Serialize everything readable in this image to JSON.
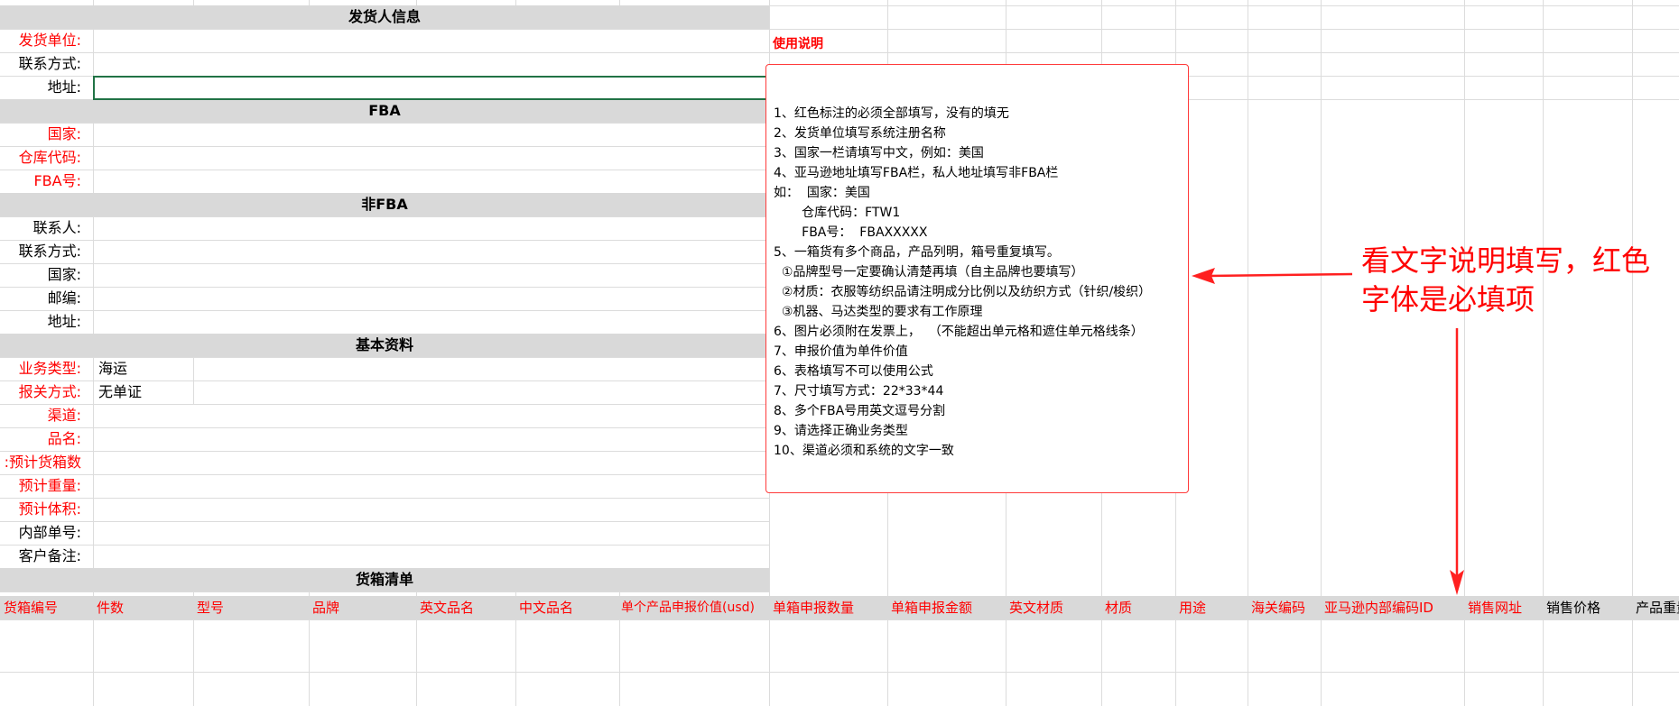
{
  "sections": {
    "shipper": "发货人信息",
    "fba": "FBA",
    "non_fba": "非FBA",
    "basic": "基本资料",
    "cargo": "货箱清单"
  },
  "shipper": {
    "unit": "发货单位:",
    "contact": "联系方式:",
    "address": "地址:"
  },
  "fba": {
    "country": "国家:",
    "warehouse": "仓库代码:",
    "fba_no": "FBA号:"
  },
  "non_fba": {
    "contact_person": "联系人:",
    "contact": "联系方式:",
    "country": "国家:",
    "postcode": "邮编:",
    "address": "地址:"
  },
  "basic": {
    "business_type": "业务类型:",
    "business_type_value": "海运",
    "customs": "报关方式:",
    "customs_value": "无单证",
    "channel": "渠道:",
    "product": "品名:",
    "boxes": "预计货箱数:",
    "weight": "预计重量:",
    "volume": "预计体积:",
    "internal_no": "内部单号:",
    "remarks": "客户备注:"
  },
  "columns": [
    "货箱编号",
    "件数",
    "型号",
    "品牌",
    "英文品名",
    "中文品名",
    "单个产品申报价值(usd)",
    "单箱申报数量",
    "单箱申报金额",
    "英文材质",
    "材质",
    "用途",
    "海关编码",
    "亚马逊内部编码ID",
    "销售网址",
    "销售价格",
    "产品重量"
  ],
  "usage_title": "使用说明",
  "notes": [
    "1、红色标注的必须全部填写，没有的填无",
    "2、发货单位填写系统注册名称",
    "3、国家一栏请填写中文，例如：美国",
    "4、亚马逊地址填写FBA栏，私人地址填写非FBA栏",
    "如：  国家：美国",
    "       仓库代码：FTW1",
    "       FBA号：  FBAXXXXX",
    "5、一箱货有多个商品，产品列明，箱号重复填写。",
    "  ①品牌型号一定要确认清楚再填（自主品牌也要填写）",
    "  ②材质：衣服等纺织品请注明成分比例以及纺织方式（针织/梭织）",
    "  ③机器、马达类型的要求有工作原理",
    "6、图片必须附在发票上，  （不能超出单元格和遮住单元格线条）",
    "7、申报价值为单件价值",
    "6、表格填写不可以使用公式",
    "7、尺寸填写方式：22*33*44",
    "8、多个FBA号用英文逗号分割",
    "9、请选择正确业务类型",
    "10、渠道必须和系统的文字一致"
  ],
  "annotation": "看文字说明填写，红色字体是必填项",
  "colors": {
    "required": "#ff0000",
    "section_bg": "#d9d9d9",
    "selection": "#217346",
    "annotation": "#ff0000"
  }
}
